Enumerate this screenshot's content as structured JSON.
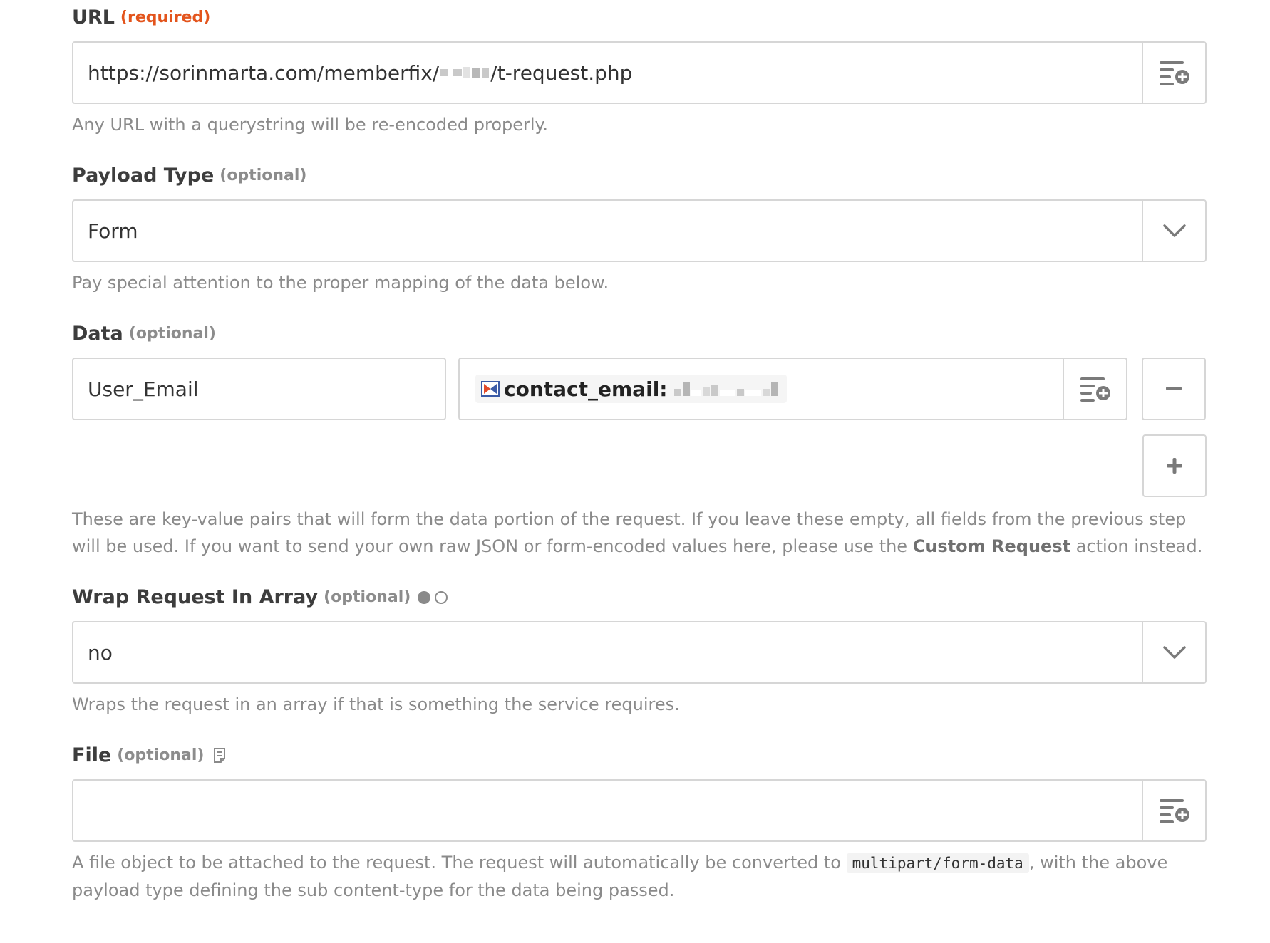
{
  "url_field": {
    "label": "URL",
    "tag": "(required)",
    "value_prefix": "https://sorinmarta.com/memberfix/",
    "value_suffix": "/t-request.php",
    "help": "Any URL with a querystring will be re-encoded properly.",
    "icon": "insert-field-icon"
  },
  "payload_field": {
    "label": "Payload Type",
    "tag": "(optional)",
    "selected": "Form",
    "help": "Pay special attention to the proper mapping of the data below.",
    "icon": "chevron-down-icon"
  },
  "data_field": {
    "label": "Data",
    "tag": "(optional)",
    "key": "User_Email",
    "token_label": "contact_email:",
    "help_part1": "These are key-value pairs that will form the data portion of the request. If you leave these empty, all fields from the previous step will be used. If you want to send your own raw JSON or form-encoded values here, please use the ",
    "help_bold": "Custom Request",
    "help_part2": " action instead."
  },
  "wrap_field": {
    "label": "Wrap Request In Array",
    "tag": "(optional)",
    "selected": "no",
    "help": "Wraps the request in an array if that is something the service requires."
  },
  "file_field": {
    "label": "File",
    "tag": "(optional)",
    "value": "",
    "help_part1": "A file object to be attached to the request. The request will automatically be converted to ",
    "help_code": "multipart/form-data",
    "help_part2": ", with the above payload type defining the sub content-type for the data being passed."
  },
  "colors": {
    "required": "#e3541c",
    "border": "#d6d6d6",
    "help_text": "#8a8a8a"
  }
}
